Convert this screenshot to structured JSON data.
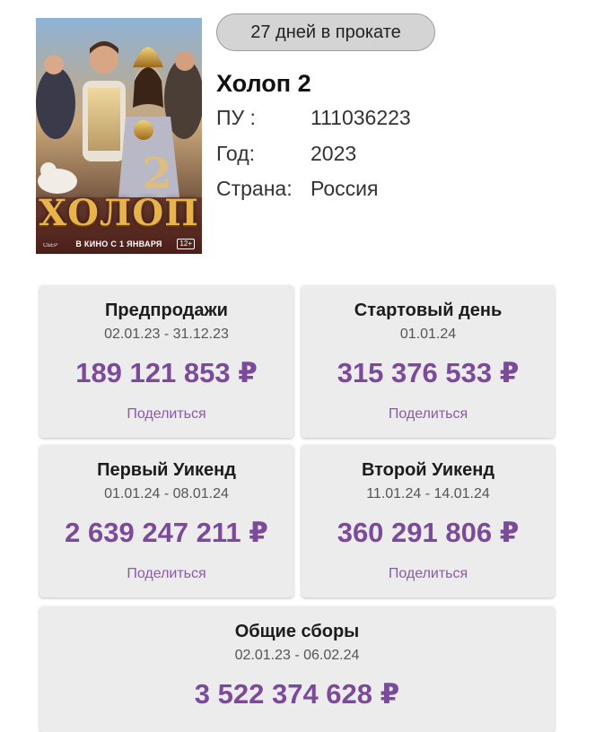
{
  "poster": {
    "title": "ХОЛОП",
    "tagline": "В КИНО С 1 ЯНВАРЯ",
    "age_rating": "12+",
    "sponsor": "СБЕР"
  },
  "badge": {
    "days_in_release": "27 дней в прокате"
  },
  "film": {
    "title": "Холоп 2",
    "pu_label": "ПУ :",
    "pu_value": "111036223",
    "year_label": "Год:",
    "year_value": "2023",
    "country_label": "Страна:",
    "country_value": "Россия"
  },
  "stats": {
    "share_label": "Поделиться",
    "presales": {
      "title": "Предпродажи",
      "dates": "02.01.23 - 31.12.23",
      "amount": "189 121 853 ₽"
    },
    "opening_day": {
      "title": "Стартовый день",
      "dates": "01.01.24",
      "amount": "315 376 533 ₽"
    },
    "first_weekend": {
      "title": "Первый Уикенд",
      "dates": "01.01.24 - 08.01.24",
      "amount": "2 639 247 211 ₽"
    },
    "second_weekend": {
      "title": "Второй Уикенд",
      "dates": "11.01.24 - 14.01.24",
      "amount": "360 291 806 ₽"
    },
    "total": {
      "title": "Общие сборы",
      "dates": "02.01.23 - 06.02.24",
      "amount": "3 522 374 628 ₽"
    }
  },
  "colors": {
    "accent": "#7c4a9a",
    "card_background": "#ececec",
    "badge_background": "#d4d4d4"
  }
}
